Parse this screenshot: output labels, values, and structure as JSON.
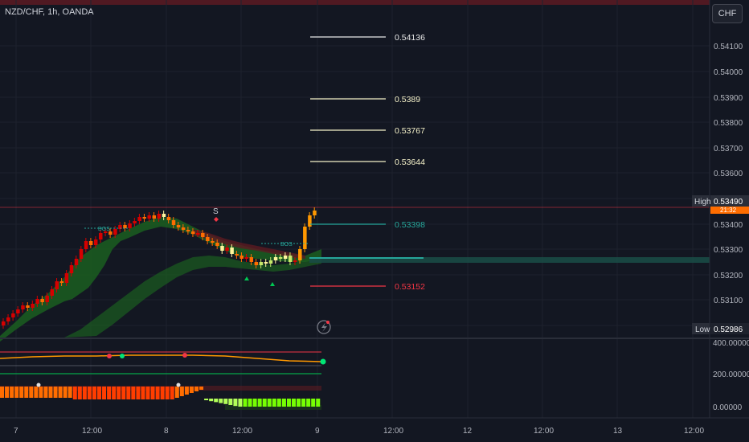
{
  "header": {
    "symbol": "NZD/CHF, 1h, OANDA",
    "currency": "CHF"
  },
  "price_axis": {
    "ticks": [
      "0.54100",
      "0.54000",
      "0.53900",
      "0.53800",
      "0.53700",
      "0.53600",
      "0.53400",
      "0.53300",
      "0.53200",
      "0.53100"
    ],
    "high_label": "High",
    "high_value": "0.53490",
    "countdown": "21:32",
    "low_label": "Low",
    "low_value": "0.52986"
  },
  "osc_axis": {
    "ticks": [
      "400.00000",
      "200.00000",
      "0.00000"
    ]
  },
  "time_axis": {
    "ticks": [
      "7",
      "12:00",
      "8",
      "12:00",
      "9",
      "12:00",
      "12",
      "12:00",
      "13",
      "12:00"
    ]
  },
  "levels": [
    {
      "value": "0.54136",
      "color": "#e8e8e8"
    },
    {
      "value": "0.5389",
      "color": "#f4f1c9"
    },
    {
      "value": "0.53767",
      "color": "#f4f1c9"
    },
    {
      "value": "0.53644",
      "color": "#f4f1c9"
    },
    {
      "value": "0.53398",
      "color": "#26a69a"
    },
    {
      "value": "0.53152",
      "color": "#f23645"
    }
  ],
  "annotations": {
    "bos_1": "BOS",
    "bos_2": "BOS",
    "swing": "S"
  },
  "colors": {
    "background": "#131722",
    "grid": "#1e222d",
    "bull": "#f7525f",
    "bear": "#ff9800",
    "band": "#1b5e20",
    "accent": "#2962ff"
  }
}
